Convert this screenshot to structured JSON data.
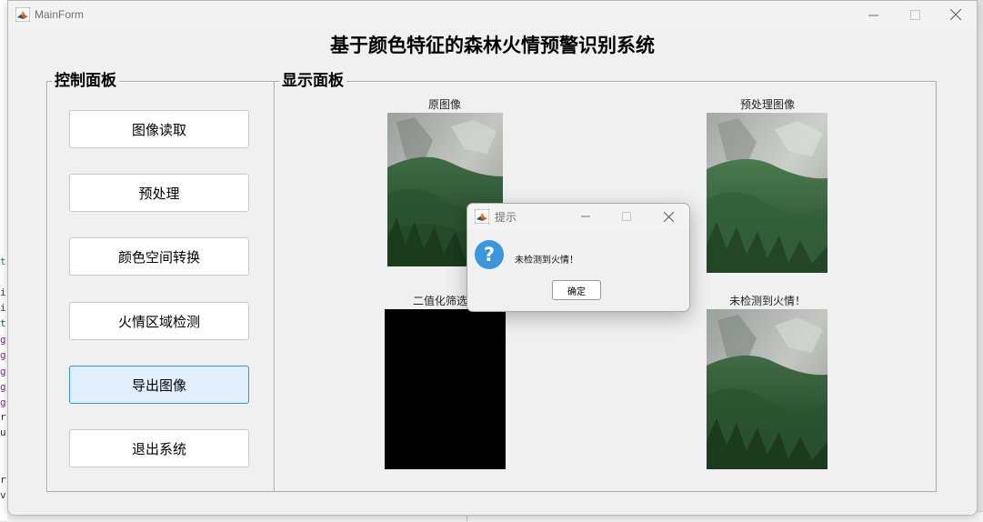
{
  "window": {
    "title": "MainForm",
    "heading": "基于颜色特征的森林火情预警识别系统",
    "minimize_glyph": "—",
    "maximize_glyph": "☐",
    "close_glyph": "✕"
  },
  "control_panel": {
    "title": "控制面板",
    "buttons": [
      {
        "label": "图像读取"
      },
      {
        "label": "预处理"
      },
      {
        "label": "颜色空间转换"
      },
      {
        "label": "火情区域检测"
      },
      {
        "label": "导出图像"
      },
      {
        "label": "退出系统"
      }
    ],
    "active_button_index": 4
  },
  "display_panel": {
    "title": "显示面板",
    "images": [
      {
        "caption": "原图像"
      },
      {
        "caption": "预处理图像"
      },
      {
        "caption": "二值化筛选"
      },
      {
        "caption": "未检测到火情！"
      }
    ]
  },
  "dialog": {
    "title": "提示",
    "message": "未检测到火情！",
    "ok_label": "确定",
    "icon": "question-icon"
  },
  "background_editor": {
    "chars": [
      "t",
      "i",
      "i",
      "t",
      "g",
      "g",
      "g",
      "g",
      "g",
      "r",
      "u",
      "r",
      "v"
    ],
    "char_colors": [
      "#2e7d32",
      "#1b5e20",
      "#1b5e20",
      "#1b5e20",
      "#8e24aa",
      "#8e24aa",
      "#8e24aa",
      "#8e24aa",
      "#8e24aa",
      "#333333",
      "#333333",
      "#333333",
      "#333333"
    ]
  },
  "colors": {
    "active_button_bg": "#e1eefb",
    "active_button_border": "#3b8fd6",
    "question_icon": "#3a96dd"
  }
}
